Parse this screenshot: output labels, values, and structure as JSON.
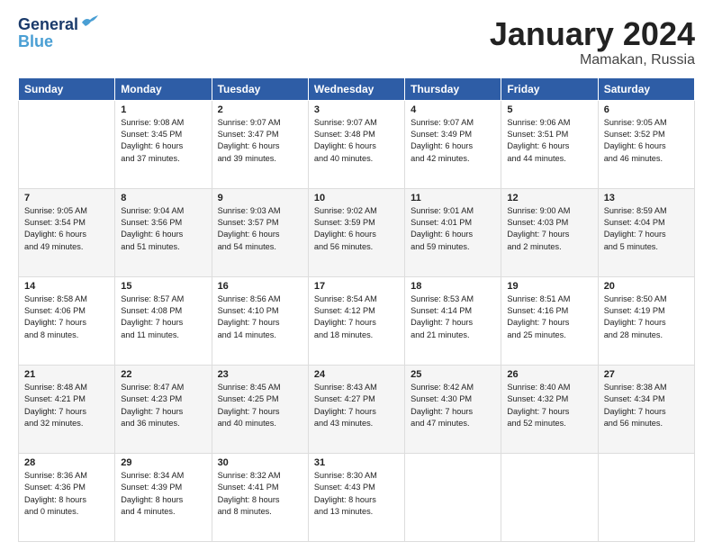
{
  "header": {
    "logo_line1": "General",
    "logo_line2": "Blue",
    "month": "January 2024",
    "location": "Mamakan, Russia"
  },
  "weekdays": [
    "Sunday",
    "Monday",
    "Tuesday",
    "Wednesday",
    "Thursday",
    "Friday",
    "Saturday"
  ],
  "weeks": [
    [
      {
        "day": "",
        "info": ""
      },
      {
        "day": "1",
        "info": "Sunrise: 9:08 AM\nSunset: 3:45 PM\nDaylight: 6 hours\nand 37 minutes."
      },
      {
        "day": "2",
        "info": "Sunrise: 9:07 AM\nSunset: 3:47 PM\nDaylight: 6 hours\nand 39 minutes."
      },
      {
        "day": "3",
        "info": "Sunrise: 9:07 AM\nSunset: 3:48 PM\nDaylight: 6 hours\nand 40 minutes."
      },
      {
        "day": "4",
        "info": "Sunrise: 9:07 AM\nSunset: 3:49 PM\nDaylight: 6 hours\nand 42 minutes."
      },
      {
        "day": "5",
        "info": "Sunrise: 9:06 AM\nSunset: 3:51 PM\nDaylight: 6 hours\nand 44 minutes."
      },
      {
        "day": "6",
        "info": "Sunrise: 9:05 AM\nSunset: 3:52 PM\nDaylight: 6 hours\nand 46 minutes."
      }
    ],
    [
      {
        "day": "7",
        "info": "Sunrise: 9:05 AM\nSunset: 3:54 PM\nDaylight: 6 hours\nand 49 minutes."
      },
      {
        "day": "8",
        "info": "Sunrise: 9:04 AM\nSunset: 3:56 PM\nDaylight: 6 hours\nand 51 minutes."
      },
      {
        "day": "9",
        "info": "Sunrise: 9:03 AM\nSunset: 3:57 PM\nDaylight: 6 hours\nand 54 minutes."
      },
      {
        "day": "10",
        "info": "Sunrise: 9:02 AM\nSunset: 3:59 PM\nDaylight: 6 hours\nand 56 minutes."
      },
      {
        "day": "11",
        "info": "Sunrise: 9:01 AM\nSunset: 4:01 PM\nDaylight: 6 hours\nand 59 minutes."
      },
      {
        "day": "12",
        "info": "Sunrise: 9:00 AM\nSunset: 4:03 PM\nDaylight: 7 hours\nand 2 minutes."
      },
      {
        "day": "13",
        "info": "Sunrise: 8:59 AM\nSunset: 4:04 PM\nDaylight: 7 hours\nand 5 minutes."
      }
    ],
    [
      {
        "day": "14",
        "info": "Sunrise: 8:58 AM\nSunset: 4:06 PM\nDaylight: 7 hours\nand 8 minutes."
      },
      {
        "day": "15",
        "info": "Sunrise: 8:57 AM\nSunset: 4:08 PM\nDaylight: 7 hours\nand 11 minutes."
      },
      {
        "day": "16",
        "info": "Sunrise: 8:56 AM\nSunset: 4:10 PM\nDaylight: 7 hours\nand 14 minutes."
      },
      {
        "day": "17",
        "info": "Sunrise: 8:54 AM\nSunset: 4:12 PM\nDaylight: 7 hours\nand 18 minutes."
      },
      {
        "day": "18",
        "info": "Sunrise: 8:53 AM\nSunset: 4:14 PM\nDaylight: 7 hours\nand 21 minutes."
      },
      {
        "day": "19",
        "info": "Sunrise: 8:51 AM\nSunset: 4:16 PM\nDaylight: 7 hours\nand 25 minutes."
      },
      {
        "day": "20",
        "info": "Sunrise: 8:50 AM\nSunset: 4:19 PM\nDaylight: 7 hours\nand 28 minutes."
      }
    ],
    [
      {
        "day": "21",
        "info": "Sunrise: 8:48 AM\nSunset: 4:21 PM\nDaylight: 7 hours\nand 32 minutes."
      },
      {
        "day": "22",
        "info": "Sunrise: 8:47 AM\nSunset: 4:23 PM\nDaylight: 7 hours\nand 36 minutes."
      },
      {
        "day": "23",
        "info": "Sunrise: 8:45 AM\nSunset: 4:25 PM\nDaylight: 7 hours\nand 40 minutes."
      },
      {
        "day": "24",
        "info": "Sunrise: 8:43 AM\nSunset: 4:27 PM\nDaylight: 7 hours\nand 43 minutes."
      },
      {
        "day": "25",
        "info": "Sunrise: 8:42 AM\nSunset: 4:30 PM\nDaylight: 7 hours\nand 47 minutes."
      },
      {
        "day": "26",
        "info": "Sunrise: 8:40 AM\nSunset: 4:32 PM\nDaylight: 7 hours\nand 52 minutes."
      },
      {
        "day": "27",
        "info": "Sunrise: 8:38 AM\nSunset: 4:34 PM\nDaylight: 7 hours\nand 56 minutes."
      }
    ],
    [
      {
        "day": "28",
        "info": "Sunrise: 8:36 AM\nSunset: 4:36 PM\nDaylight: 8 hours\nand 0 minutes."
      },
      {
        "day": "29",
        "info": "Sunrise: 8:34 AM\nSunset: 4:39 PM\nDaylight: 8 hours\nand 4 minutes."
      },
      {
        "day": "30",
        "info": "Sunrise: 8:32 AM\nSunset: 4:41 PM\nDaylight: 8 hours\nand 8 minutes."
      },
      {
        "day": "31",
        "info": "Sunrise: 8:30 AM\nSunset: 4:43 PM\nDaylight: 8 hours\nand 13 minutes."
      },
      {
        "day": "",
        "info": ""
      },
      {
        "day": "",
        "info": ""
      },
      {
        "day": "",
        "info": ""
      }
    ]
  ]
}
